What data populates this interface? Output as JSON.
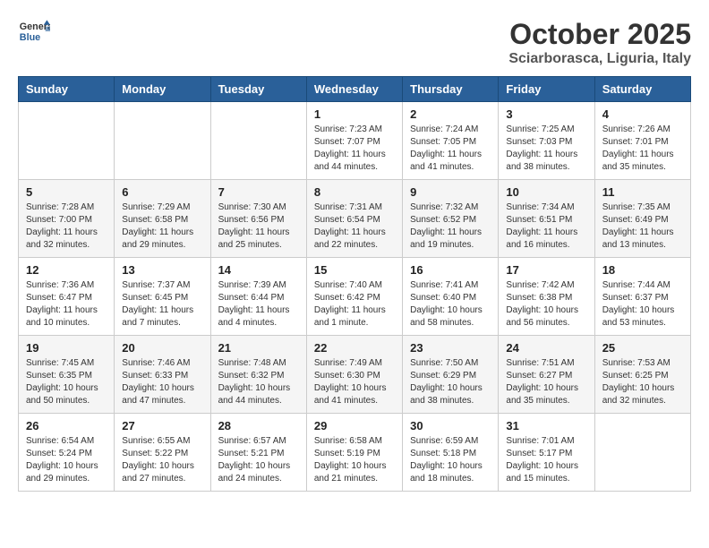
{
  "header": {
    "logo": {
      "line1": "General",
      "line2": "Blue"
    },
    "month": "October 2025",
    "location": "Sciarborasca, Liguria, Italy"
  },
  "weekdays": [
    "Sunday",
    "Monday",
    "Tuesday",
    "Wednesday",
    "Thursday",
    "Friday",
    "Saturday"
  ],
  "weeks": [
    [
      {
        "day": "",
        "info": ""
      },
      {
        "day": "",
        "info": ""
      },
      {
        "day": "",
        "info": ""
      },
      {
        "day": "1",
        "info": "Sunrise: 7:23 AM\nSunset: 7:07 PM\nDaylight: 11 hours\nand 44 minutes."
      },
      {
        "day": "2",
        "info": "Sunrise: 7:24 AM\nSunset: 7:05 PM\nDaylight: 11 hours\nand 41 minutes."
      },
      {
        "day": "3",
        "info": "Sunrise: 7:25 AM\nSunset: 7:03 PM\nDaylight: 11 hours\nand 38 minutes."
      },
      {
        "day": "4",
        "info": "Sunrise: 7:26 AM\nSunset: 7:01 PM\nDaylight: 11 hours\nand 35 minutes."
      }
    ],
    [
      {
        "day": "5",
        "info": "Sunrise: 7:28 AM\nSunset: 7:00 PM\nDaylight: 11 hours\nand 32 minutes."
      },
      {
        "day": "6",
        "info": "Sunrise: 7:29 AM\nSunset: 6:58 PM\nDaylight: 11 hours\nand 29 minutes."
      },
      {
        "day": "7",
        "info": "Sunrise: 7:30 AM\nSunset: 6:56 PM\nDaylight: 11 hours\nand 25 minutes."
      },
      {
        "day": "8",
        "info": "Sunrise: 7:31 AM\nSunset: 6:54 PM\nDaylight: 11 hours\nand 22 minutes."
      },
      {
        "day": "9",
        "info": "Sunrise: 7:32 AM\nSunset: 6:52 PM\nDaylight: 11 hours\nand 19 minutes."
      },
      {
        "day": "10",
        "info": "Sunrise: 7:34 AM\nSunset: 6:51 PM\nDaylight: 11 hours\nand 16 minutes."
      },
      {
        "day": "11",
        "info": "Sunrise: 7:35 AM\nSunset: 6:49 PM\nDaylight: 11 hours\nand 13 minutes."
      }
    ],
    [
      {
        "day": "12",
        "info": "Sunrise: 7:36 AM\nSunset: 6:47 PM\nDaylight: 11 hours\nand 10 minutes."
      },
      {
        "day": "13",
        "info": "Sunrise: 7:37 AM\nSunset: 6:45 PM\nDaylight: 11 hours\nand 7 minutes."
      },
      {
        "day": "14",
        "info": "Sunrise: 7:39 AM\nSunset: 6:44 PM\nDaylight: 11 hours\nand 4 minutes."
      },
      {
        "day": "15",
        "info": "Sunrise: 7:40 AM\nSunset: 6:42 PM\nDaylight: 11 hours\nand 1 minute."
      },
      {
        "day": "16",
        "info": "Sunrise: 7:41 AM\nSunset: 6:40 PM\nDaylight: 10 hours\nand 58 minutes."
      },
      {
        "day": "17",
        "info": "Sunrise: 7:42 AM\nSunset: 6:38 PM\nDaylight: 10 hours\nand 56 minutes."
      },
      {
        "day": "18",
        "info": "Sunrise: 7:44 AM\nSunset: 6:37 PM\nDaylight: 10 hours\nand 53 minutes."
      }
    ],
    [
      {
        "day": "19",
        "info": "Sunrise: 7:45 AM\nSunset: 6:35 PM\nDaylight: 10 hours\nand 50 minutes."
      },
      {
        "day": "20",
        "info": "Sunrise: 7:46 AM\nSunset: 6:33 PM\nDaylight: 10 hours\nand 47 minutes."
      },
      {
        "day": "21",
        "info": "Sunrise: 7:48 AM\nSunset: 6:32 PM\nDaylight: 10 hours\nand 44 minutes."
      },
      {
        "day": "22",
        "info": "Sunrise: 7:49 AM\nSunset: 6:30 PM\nDaylight: 10 hours\nand 41 minutes."
      },
      {
        "day": "23",
        "info": "Sunrise: 7:50 AM\nSunset: 6:29 PM\nDaylight: 10 hours\nand 38 minutes."
      },
      {
        "day": "24",
        "info": "Sunrise: 7:51 AM\nSunset: 6:27 PM\nDaylight: 10 hours\nand 35 minutes."
      },
      {
        "day": "25",
        "info": "Sunrise: 7:53 AM\nSunset: 6:25 PM\nDaylight: 10 hours\nand 32 minutes."
      }
    ],
    [
      {
        "day": "26",
        "info": "Sunrise: 6:54 AM\nSunset: 5:24 PM\nDaylight: 10 hours\nand 29 minutes."
      },
      {
        "day": "27",
        "info": "Sunrise: 6:55 AM\nSunset: 5:22 PM\nDaylight: 10 hours\nand 27 minutes."
      },
      {
        "day": "28",
        "info": "Sunrise: 6:57 AM\nSunset: 5:21 PM\nDaylight: 10 hours\nand 24 minutes."
      },
      {
        "day": "29",
        "info": "Sunrise: 6:58 AM\nSunset: 5:19 PM\nDaylight: 10 hours\nand 21 minutes."
      },
      {
        "day": "30",
        "info": "Sunrise: 6:59 AM\nSunset: 5:18 PM\nDaylight: 10 hours\nand 18 minutes."
      },
      {
        "day": "31",
        "info": "Sunrise: 7:01 AM\nSunset: 5:17 PM\nDaylight: 10 hours\nand 15 minutes."
      },
      {
        "day": "",
        "info": ""
      }
    ]
  ]
}
